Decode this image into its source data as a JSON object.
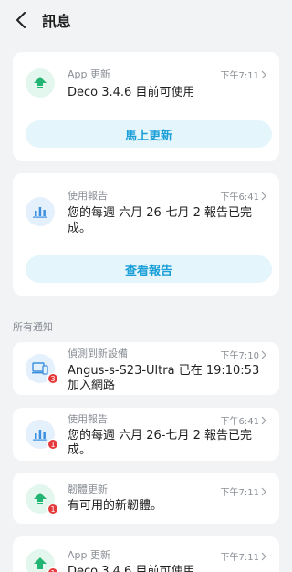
{
  "header": {
    "title": "訊息",
    "back_icon": "chevron-left-icon"
  },
  "featured": [
    {
      "label": "App 更新",
      "time": "下午7:11",
      "message": "Deco 3.4.6 目前可使用",
      "button": "馬上更新",
      "icon": "arrow-up-icon"
    },
    {
      "label": "使用報告",
      "time": "下午6:41",
      "message_line1": "您的每週 六月 26-七月 2 報告已完",
      "message_line2": "成。",
      "button": "查看報告",
      "icon": "bar-chart-icon"
    }
  ],
  "section": {
    "title": "所有通知"
  },
  "notifications": [
    {
      "label": "偵測到新設備",
      "time": "下午7:10",
      "message_line1": "Angus-s-S23-Ultra 已在 19:10:53",
      "message_line2": "加入網路",
      "badge": "3",
      "icon": "devices-icon"
    },
    {
      "label": "使用報告",
      "time": "下午6:41",
      "message_line1": "您的每週 六月 26-七月 2 報告已完",
      "message_line2": "成。",
      "badge": "1",
      "icon": "bar-chart-icon"
    },
    {
      "label": "韌體更新",
      "time": "下午7:11",
      "message_line1": "有可用的新韌體。",
      "badge": "1",
      "icon": "arrow-up-icon"
    },
    {
      "label": "App 更新",
      "time": "下午7:11",
      "message_line1": "Deco 3.4.6 目前可使用",
      "badge": "1",
      "icon": "arrow-up-icon"
    }
  ],
  "colors": {
    "accent": "#1a9fd9",
    "green": "#22b573",
    "blue": "#3b8fe0",
    "badge": "#e5393c"
  }
}
